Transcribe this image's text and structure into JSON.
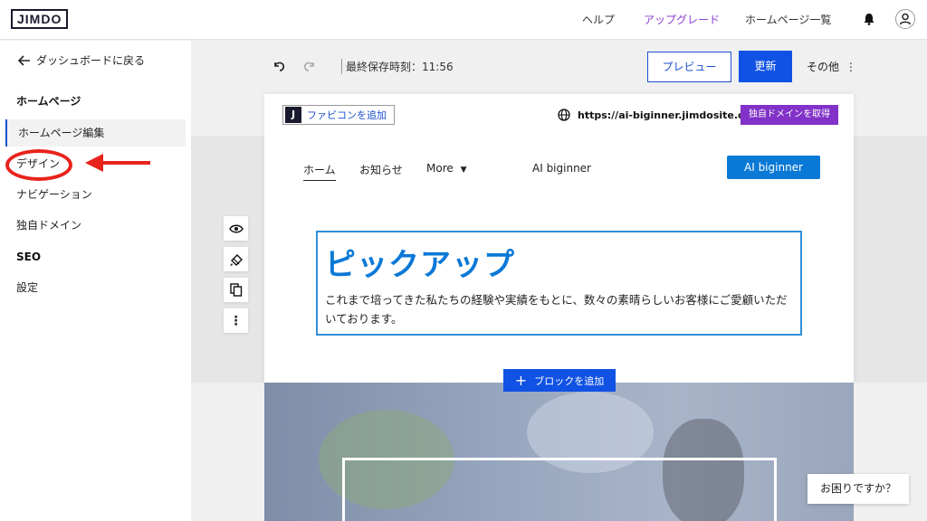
{
  "header": {
    "logo": "JIMDO",
    "nav": [
      "ヘルプ",
      "アップグレード",
      "ホームページ一覧"
    ],
    "accent_color": "#8a3fd1",
    "bell_icon": "bell-icon",
    "user_icon": "user-icon"
  },
  "sidebar": {
    "back_label": "ダッシュボードに戻る",
    "section_homepage": "ホームページ",
    "items": [
      {
        "label": "ホームページ編集",
        "active": true
      },
      {
        "label": "デザイン",
        "active": false
      },
      {
        "label": "ナビゲーション",
        "active": false
      },
      {
        "label": "独自ドメイン",
        "active": false
      }
    ],
    "section_seo": "SEO",
    "settings_label": "設定"
  },
  "toolbar": {
    "save_time": "最終保存時刻：11:56",
    "preview_label": "プレビュー",
    "update_label": "更新",
    "more_label": "その他"
  },
  "site": {
    "favicon_logo": "J",
    "favicon_label": "ファビコンを追加",
    "url": "https://ai-biginner.jimdosite.com",
    "domain_button": "独自ドメインを取得",
    "nav": {
      "home": "ホーム",
      "news": "お知らせ",
      "more": "More",
      "brand": "AI biginner",
      "cta": "AI biginner"
    },
    "pickup_title": "ピックアップ",
    "pickup_text": "これまで培ってきた私たちの経験や実績をもとに、数々の素晴らしいお客様にご愛顧いただいております。",
    "add_block_label": "ブロックを追加"
  },
  "help_button": "お困りですか？",
  "colors": {
    "primary_blue": "#1052e4",
    "site_blue": "#0a79d6",
    "purple": "#8232c8",
    "annotation_red": "#e8231c"
  }
}
